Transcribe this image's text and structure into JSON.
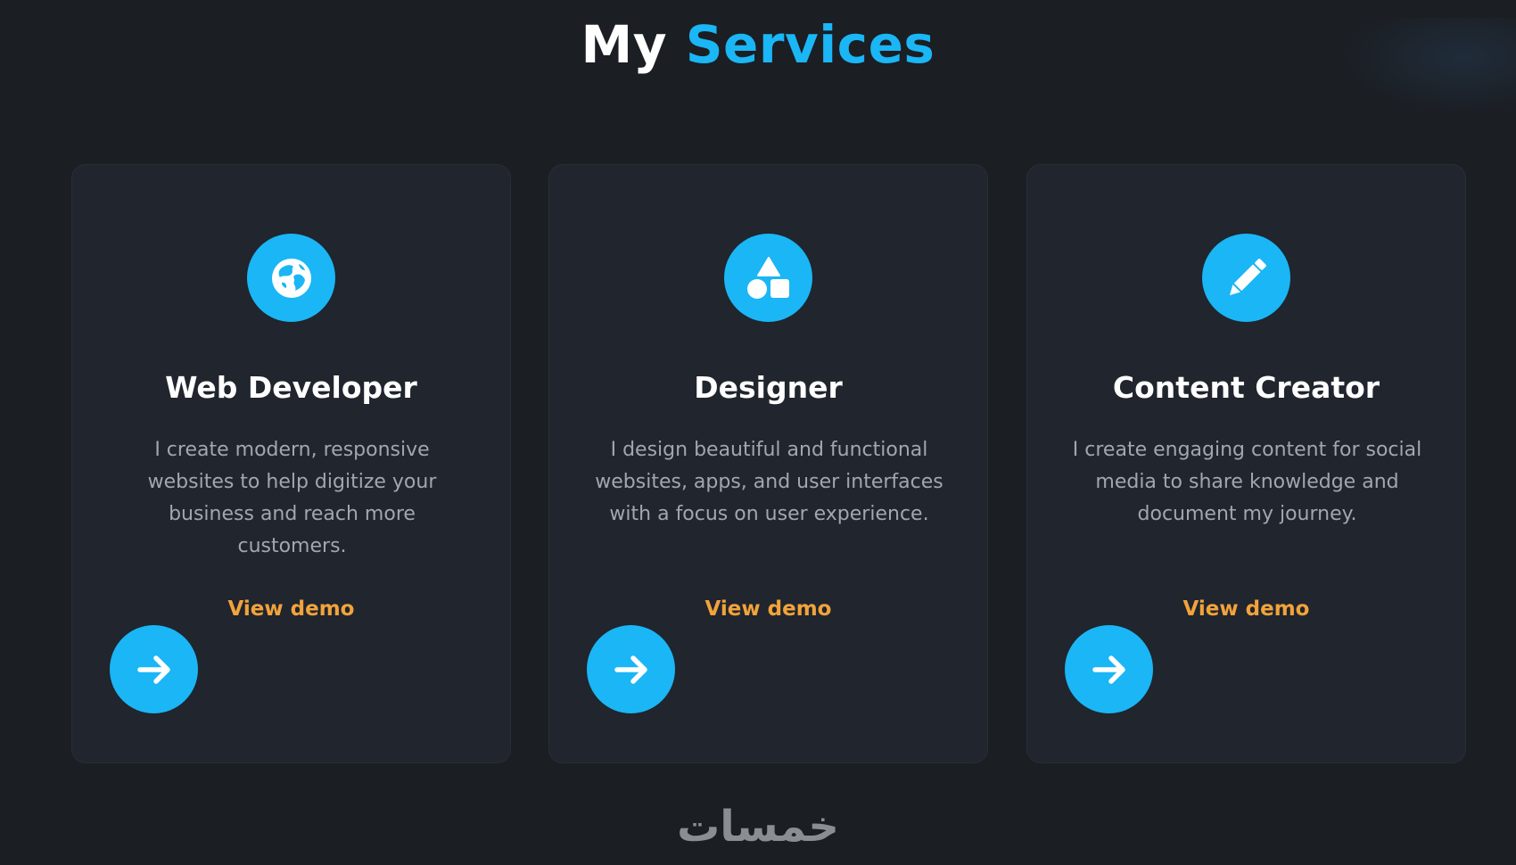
{
  "section": {
    "title_part1": "My",
    "title_part2": "Services"
  },
  "colors": {
    "accent": "#1ab6f5",
    "link": "#f2a33a",
    "card_bg": "#20252e",
    "page_bg": "#1b1e23"
  },
  "cards": [
    {
      "icon": "globe-icon",
      "title": "Web Developer",
      "description": "I create modern, responsive websites to help digitize your business and reach more customers.",
      "link_label": "View demo",
      "button_icon": "arrow-right-icon"
    },
    {
      "icon": "shapes-icon",
      "title": "Designer",
      "description": "I design beautiful and functional websites, apps, and user interfaces with a focus on user experience.",
      "link_label": "View demo",
      "button_icon": "arrow-right-icon"
    },
    {
      "icon": "pencil-icon",
      "title": "Content Creator",
      "description": "I create engaging content for social media to share knowledge and document my journey.",
      "link_label": "View demo",
      "button_icon": "arrow-right-icon"
    }
  ],
  "watermark": {
    "text": "خمسات"
  }
}
